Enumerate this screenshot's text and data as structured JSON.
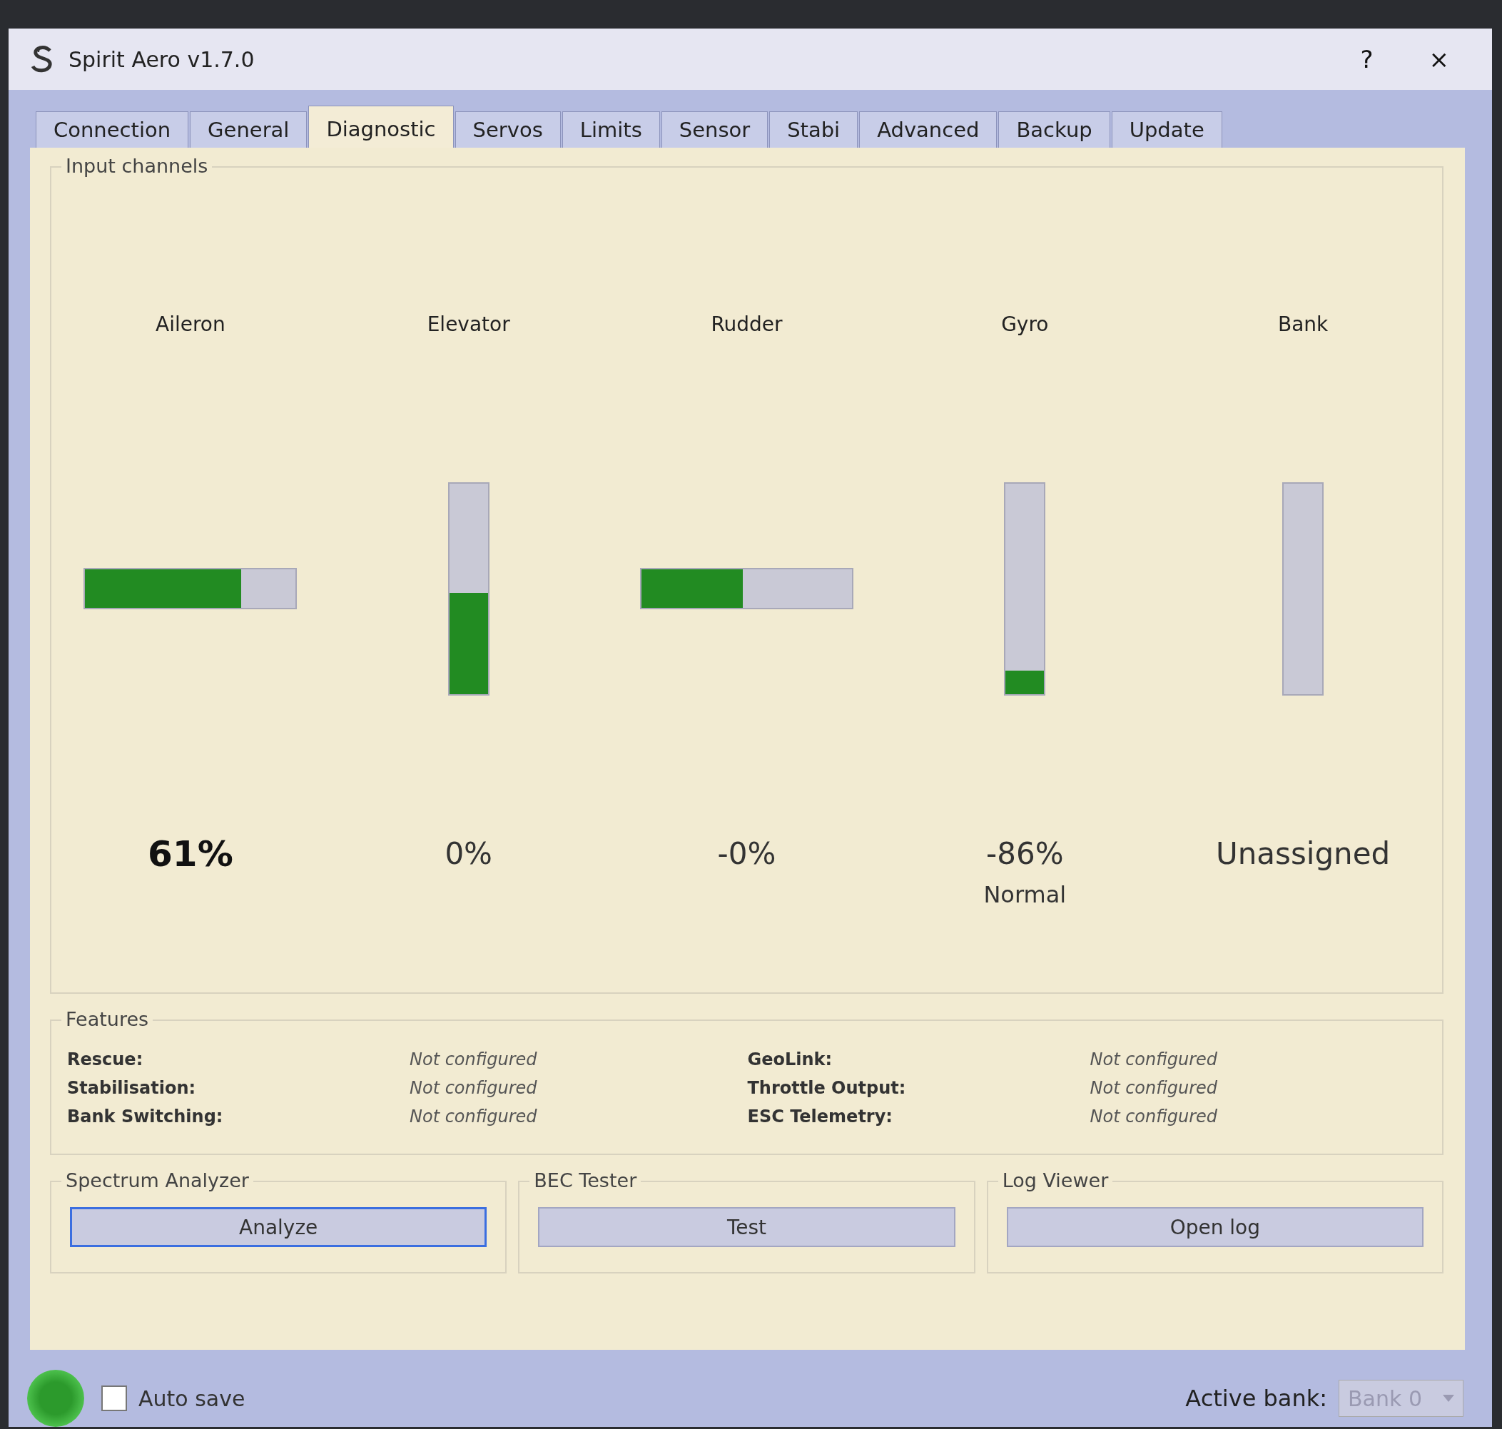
{
  "window": {
    "title": "Spirit Aero v1.7.0",
    "help": "?",
    "close": "×"
  },
  "tabs": [
    {
      "label": "Connection",
      "selected": false
    },
    {
      "label": "General",
      "selected": false
    },
    {
      "label": "Diagnostic",
      "selected": true
    },
    {
      "label": "Servos",
      "selected": false
    },
    {
      "label": "Limits",
      "selected": false
    },
    {
      "label": "Sensor",
      "selected": false
    },
    {
      "label": "Stabi",
      "selected": false
    },
    {
      "label": "Advanced",
      "selected": false
    },
    {
      "label": "Backup",
      "selected": false
    },
    {
      "label": "Update",
      "selected": false
    }
  ],
  "input_channels": {
    "title": "Input channels",
    "channels": [
      {
        "name": "Aileron",
        "kind": "horizontal",
        "level": 0.74,
        "value": "61%",
        "emphasized": true
      },
      {
        "name": "Elevator",
        "kind": "vertical",
        "level": 0.48,
        "value": "0%",
        "emphasized": false
      },
      {
        "name": "Rudder",
        "kind": "horizontal",
        "level": 0.48,
        "value": "-0%",
        "emphasized": false
      },
      {
        "name": "Gyro",
        "kind": "vertical",
        "level": 0.11,
        "value": "-86%",
        "emphasized": false,
        "mode": "Normal"
      },
      {
        "name": "Bank",
        "kind": "vertical",
        "level": 0,
        "value": "Unassigned",
        "emphasized": false
      }
    ]
  },
  "features": {
    "title": "Features",
    "columns": [
      [
        {
          "label": "Rescue:",
          "value": "Not configured"
        },
        {
          "label": "Stabilisation:",
          "value": "Not configured"
        },
        {
          "label": "Bank Switching:",
          "value": "Not configured"
        }
      ],
      [
        {
          "label": "GeoLink:",
          "value": "Not configured"
        },
        {
          "label": "Throttle Output:",
          "value": "Not configured"
        },
        {
          "label": "ESC Telemetry:",
          "value": "Not configured"
        }
      ]
    ]
  },
  "tools": [
    {
      "title": "Spectrum Analyzer",
      "button": "Analyze",
      "focused": true
    },
    {
      "title": "BEC Tester",
      "button": "Test",
      "focused": false
    },
    {
      "title": "Log Viewer",
      "button": "Open log",
      "focused": false
    }
  ],
  "status_bar": {
    "auto_save": {
      "label": "Auto save",
      "checked": false
    },
    "active_bank": {
      "label": "Active bank:",
      "value": "Bank 0",
      "disabled": true
    }
  }
}
